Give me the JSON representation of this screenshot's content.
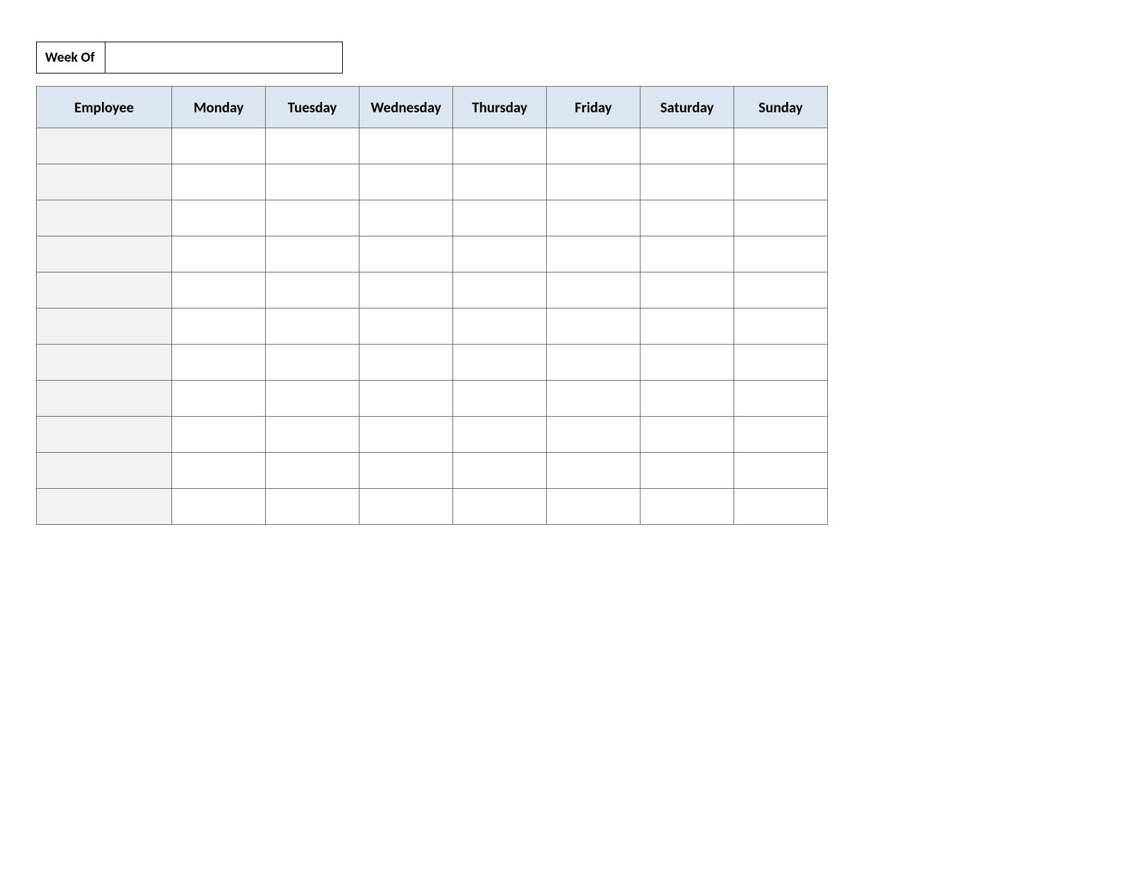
{
  "week_of": {
    "label": "Week Of",
    "value": ""
  },
  "headers": {
    "employee": "Employee",
    "days": [
      "Monday",
      "Tuesday",
      "Wednesday",
      "Thursday",
      "Friday",
      "Saturday",
      "Sunday"
    ]
  },
  "rows": [
    {
      "employee": "",
      "cells": [
        "",
        "",
        "",
        "",
        "",
        "",
        ""
      ]
    },
    {
      "employee": "",
      "cells": [
        "",
        "",
        "",
        "",
        "",
        "",
        ""
      ]
    },
    {
      "employee": "",
      "cells": [
        "",
        "",
        "",
        "",
        "",
        "",
        ""
      ]
    },
    {
      "employee": "",
      "cells": [
        "",
        "",
        "",
        "",
        "",
        "",
        ""
      ]
    },
    {
      "employee": "",
      "cells": [
        "",
        "",
        "",
        "",
        "",
        "",
        ""
      ]
    },
    {
      "employee": "",
      "cells": [
        "",
        "",
        "",
        "",
        "",
        "",
        ""
      ]
    },
    {
      "employee": "",
      "cells": [
        "",
        "",
        "",
        "",
        "",
        "",
        ""
      ]
    },
    {
      "employee": "",
      "cells": [
        "",
        "",
        "",
        "",
        "",
        "",
        ""
      ]
    },
    {
      "employee": "",
      "cells": [
        "",
        "",
        "",
        "",
        "",
        "",
        ""
      ]
    },
    {
      "employee": "",
      "cells": [
        "",
        "",
        "",
        "",
        "",
        "",
        ""
      ]
    },
    {
      "employee": "",
      "cells": [
        "",
        "",
        "",
        "",
        "",
        "",
        ""
      ]
    }
  ]
}
